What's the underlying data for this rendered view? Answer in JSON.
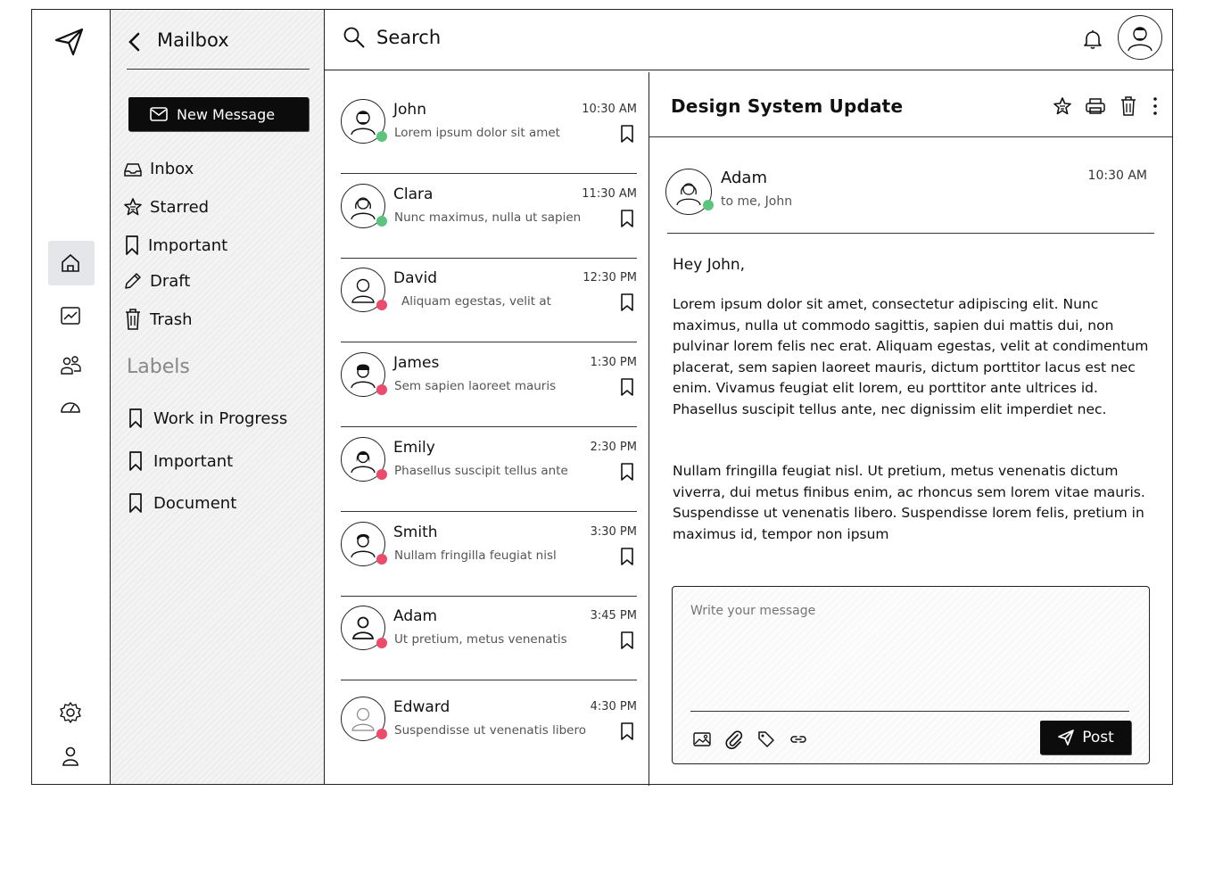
{
  "colors": {
    "online": "#5cc57d",
    "busy": "#ec4c6c",
    "active_bg": "#e4e6ea",
    "dark": "#0c0c0c"
  },
  "rail": {
    "icons": [
      "paper-plane-logo-icon",
      "home-icon",
      "chart-icon",
      "users-icon",
      "speedometer-icon",
      "gear-icon",
      "user-icon"
    ]
  },
  "sidebar": {
    "title": "Mailbox",
    "new_message": "New Message",
    "nav": [
      {
        "label": "Inbox",
        "icon": "inbox-icon"
      },
      {
        "label": "Starred",
        "icon": "star-icon"
      },
      {
        "label": "Important",
        "icon": "bookmark-icon"
      },
      {
        "label": "Draft",
        "icon": "pencil-icon"
      },
      {
        "label": "Trash",
        "icon": "trash-icon"
      }
    ],
    "labels_heading": "Labels",
    "labels": [
      "Work in Progress",
      "Important",
      "Document"
    ]
  },
  "topbar": {
    "search_label": "Search"
  },
  "messages": [
    {
      "name": "John",
      "time": "10:30 AM",
      "preview": "Lorem ipsum dolor sit amet",
      "status": "online"
    },
    {
      "name": "Clara",
      "time": "11:30 AM",
      "preview": "Nunc maximus, nulla ut sapien",
      "status": "online"
    },
    {
      "name": "David",
      "time": "12:30 PM",
      "preview": "Aliquam egestas, velit at",
      "status": "busy"
    },
    {
      "name": "James",
      "time": "1:30 PM",
      "preview": "Sem sapien laoreet mauris",
      "status": "busy"
    },
    {
      "name": "Emily",
      "time": "2:30 PM",
      "preview": "Phasellus suscipit tellus ante",
      "status": "busy"
    },
    {
      "name": "Smith",
      "time": "3:30 PM",
      "preview": "Nullam fringilla feugiat nisl",
      "status": "busy"
    },
    {
      "name": "Adam",
      "time": "3:45 PM",
      "preview": "Ut pretium, metus venenatis",
      "status": "busy"
    },
    {
      "name": "Edward",
      "time": "4:30 PM",
      "preview": "Suspendisse ut venenatis libero",
      "status": "busy"
    }
  ],
  "detail": {
    "subject": "Design System Update",
    "sender": "Adam",
    "recipient": "to me, John",
    "time": "10:30 AM",
    "greeting": "Hey John,",
    "paragraph1": "Lorem ipsum dolor sit amet, consectetur adipiscing elit. Nunc maximus, nulla ut commodo sagittis, sapien dui mattis dui, non pulvinar lorem felis nec erat. Aliquam egestas, velit at condimentum placerat, sem sapien laoreet mauris, dictum porttitor lacus est nec enim. Vivamus feugiat elit lorem, eu porttitor ante ultrices id. Phasellus suscipit tellus ante, nec dignissim elit imperdiet nec.",
    "paragraph2": "Nullam fringilla feugiat nisl. Ut pretium, metus venenatis dictum viverra, dui metus finibus enim, ac rhoncus sem lorem vitae mauris. Suspendisse ut venenatis libero. Suspendisse lorem felis, pretium in maximus id, tempor non ipsum",
    "compose_placeholder": "Write your message",
    "post_label": "Post"
  }
}
